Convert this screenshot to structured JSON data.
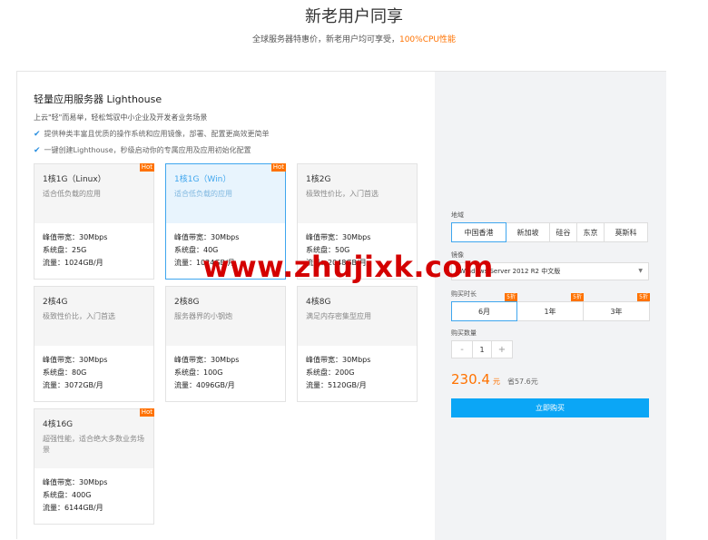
{
  "header": {
    "title": "新老用户同享",
    "subtitle_prefix": "全球服务器特惠价，新老用户均可享受，",
    "subtitle_highlight": "100%CPU性能"
  },
  "product": {
    "title": "轻量应用服务器 Lighthouse",
    "desc": "上云\"轻\"而易举，轻松驾驭中小企业及开发者业务场景",
    "features": [
      "提供种类丰富且优质的操作系统和应用镜像，部署、配置更高效更简单",
      "一键创建Lighthouse，秒级启动你的专属应用及应用初始化配置"
    ]
  },
  "cards": [
    {
      "name": "1核1G（Linux）",
      "sub": "适合低负载的应用",
      "bandwidth": "峰值带宽：30Mbps",
      "disk": "系统盘：25G",
      "traffic": "流量：1024GB/月",
      "hot": "Hot"
    },
    {
      "name": "1核1G（Win）",
      "sub": "适合低负载的应用",
      "bandwidth": "峰值带宽：30Mbps",
      "disk": "系统盘：40G",
      "traffic": "流量：1024GB/月",
      "hot": "Hot"
    },
    {
      "name": "1核2G",
      "sub": "极致性价比，入门首选",
      "bandwidth": "峰值带宽：30Mbps",
      "disk": "系统盘：50G",
      "traffic": "流量：2048GB/月",
      "hot": ""
    },
    {
      "name": "2核4G",
      "sub": "极致性价比，入门首选",
      "bandwidth": "峰值带宽：30Mbps",
      "disk": "系统盘：80G",
      "traffic": "流量：3072GB/月",
      "hot": ""
    },
    {
      "name": "2核8G",
      "sub": "服务器界的小钢炮",
      "bandwidth": "峰值带宽：30Mbps",
      "disk": "系统盘：100G",
      "traffic": "流量：4096GB/月",
      "hot": ""
    },
    {
      "name": "4核8G",
      "sub": "满足内存密集型应用",
      "bandwidth": "峰值带宽：30Mbps",
      "disk": "系统盘：200G",
      "traffic": "流量：5120GB/月",
      "hot": ""
    },
    {
      "name": "4核16G",
      "sub": "超强性能，适合绝大多数业务场景",
      "bandwidth": "峰值带宽：30Mbps",
      "disk": "系统盘：400G",
      "traffic": "流量：6144GB/月",
      "hot": "Hot"
    }
  ],
  "config": {
    "region_label": "地域",
    "regions": [
      "中国香港",
      "新加坡",
      "硅谷",
      "东京",
      "莫斯科"
    ],
    "image_label": "镜像",
    "image_value": "Windows Server 2012 R2 中文版",
    "duration_label": "购买时长",
    "durations": [
      {
        "label": "6月",
        "discount": "5折"
      },
      {
        "label": "1年",
        "discount": "5折"
      },
      {
        "label": "3年",
        "discount": "5折"
      }
    ],
    "quantity_label": "购买数量",
    "quantity": "1",
    "minus": "-",
    "plus": "+",
    "price": "230.4",
    "price_unit": "元",
    "save": "省57.6元",
    "buy_label": "立即购买"
  },
  "watermark": "www.zhujixk.com",
  "colors": {
    "accent": "#3fa6ee",
    "orange": "#ff7200",
    "buy": "#0ba6f6"
  }
}
